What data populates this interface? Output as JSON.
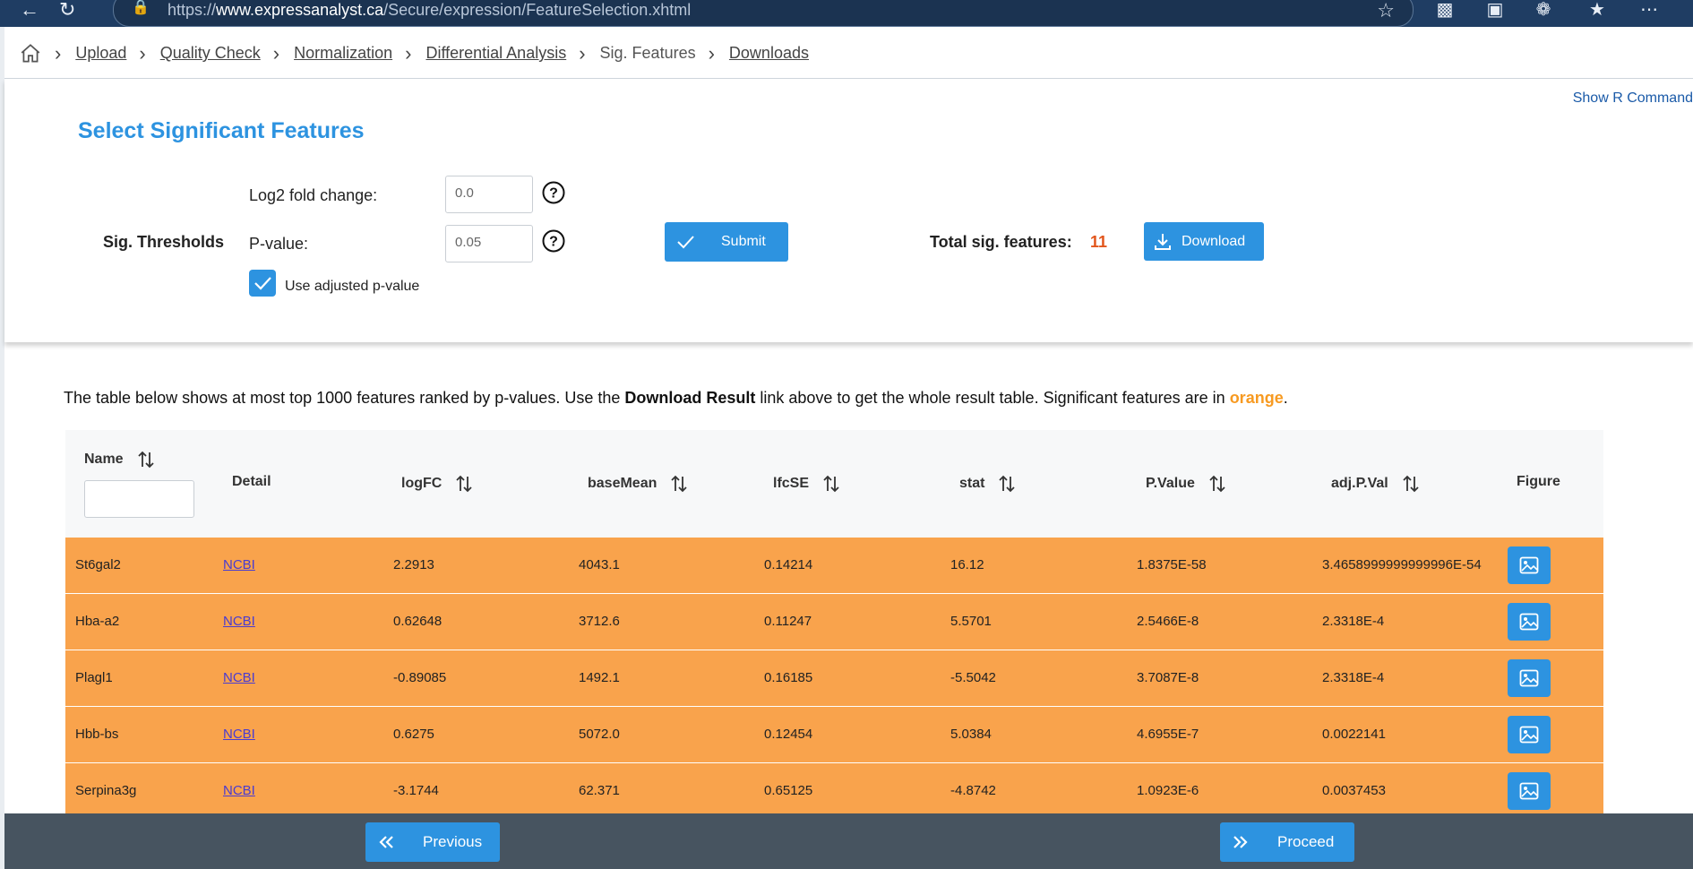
{
  "browser": {
    "url_prefix": "https://",
    "url_domain": "www.expressanalyst.ca",
    "url_path": "/Secure/expression/FeatureSelection.xhtml"
  },
  "breadcrumb": {
    "items": [
      {
        "label": "Upload"
      },
      {
        "label": "Quality Check"
      },
      {
        "label": "Normalization"
      },
      {
        "label": "Differential Analysis"
      },
      {
        "label": "Sig. Features"
      },
      {
        "label": "Downloads"
      }
    ]
  },
  "panel": {
    "show_r": "Show R Command",
    "title": "Select Significant Features",
    "sig_label": "Sig. Thresholds",
    "log2_label": "Log2 fold change:",
    "log2_value": "0.0",
    "pvalue_label": "P-value:",
    "pvalue_value": "0.05",
    "adjusted_label": "Use adjusted p-value",
    "adjusted_checked": true,
    "submit_label": "Submit",
    "total_label": "Total sig. features:",
    "total_count": "11",
    "download_label": "Download"
  },
  "info": {
    "part1": "The table below shows at most top 1000 features ranked by p-values. Use the ",
    "bold": "Download Result",
    "part2": " link above to get the whole result table. Significant features are in ",
    "orange": "orange",
    "part3": "."
  },
  "table": {
    "headers": {
      "name": "Name",
      "detail": "Detail",
      "logfc": "logFC",
      "basemean": "baseMean",
      "lfcse": "lfcSE",
      "stat": "stat",
      "pvalue": "P.Value",
      "adjp": "adj.P.Val",
      "figure": "Figure"
    },
    "rows": [
      {
        "name": "St6gal2",
        "detail": "NCBI",
        "logfc": "2.2913",
        "basemean": "4043.1",
        "lfcse": "0.14214",
        "stat": "16.12",
        "pvalue": "1.8375E-58",
        "adjp": "3.4658999999999996E-54"
      },
      {
        "name": "Hba-a2",
        "detail": "NCBI",
        "logfc": "0.62648",
        "basemean": "3712.6",
        "lfcse": "0.11247",
        "stat": "5.5701",
        "pvalue": "2.5466E-8",
        "adjp": "2.3318E-4"
      },
      {
        "name": "Plagl1",
        "detail": "NCBI",
        "logfc": "-0.89085",
        "basemean": "1492.1",
        "lfcse": "0.16185",
        "stat": "-5.5042",
        "pvalue": "3.7087E-8",
        "adjp": "2.3318E-4"
      },
      {
        "name": "Hbb-bs",
        "detail": "NCBI",
        "logfc": "0.6275",
        "basemean": "5072.0",
        "lfcse": "0.12454",
        "stat": "5.0384",
        "pvalue": "4.6955E-7",
        "adjp": "0.0022141"
      },
      {
        "name": "Serpina3g",
        "detail": "NCBI",
        "logfc": "-3.1744",
        "basemean": "62.371",
        "lfcse": "0.65125",
        "stat": "-4.8742",
        "pvalue": "1.0923E-6",
        "adjp": "0.0037453"
      }
    ]
  },
  "footer": {
    "previous_label": "Previous",
    "proceed_label": "Proceed"
  },
  "colors": {
    "accent": "#2d93e0",
    "sig_row": "#f9a34c",
    "count": "#e2561c",
    "footer": "#475460"
  }
}
